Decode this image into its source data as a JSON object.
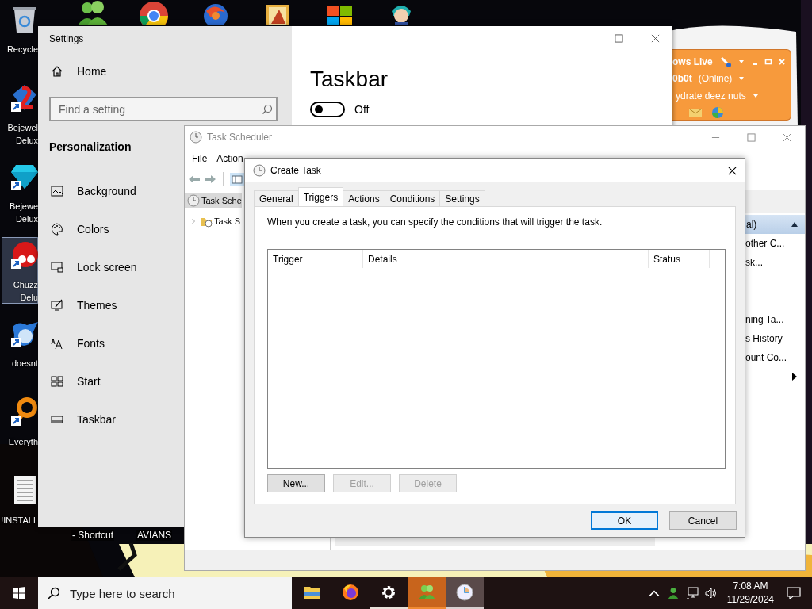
{
  "desktop": {
    "top_icons": [
      {
        "kind": "people"
      },
      {
        "kind": "ring"
      },
      {
        "kind": "swirl"
      },
      {
        "kind": "painting"
      },
      {
        "kind": "tiles"
      },
      {
        "kind": "figure"
      }
    ],
    "icons": [
      {
        "kind": "trash",
        "lines": [
          "Recycle"
        ],
        "shortcut": false,
        "selected": false
      },
      {
        "kind": "gem-red",
        "lines": [
          "Bejewel",
          "Delux"
        ],
        "shortcut": true,
        "selected": false
      },
      {
        "kind": "gem-blue",
        "lines": [
          "Bejewe",
          "Delux"
        ],
        "shortcut": true,
        "selected": false
      },
      {
        "kind": "creature",
        "lines": [
          "Chuzz",
          "Delu"
        ],
        "shortcut": true,
        "selected": true
      },
      {
        "kind": "bird",
        "lines": [
          "doesnt"
        ],
        "shortcut": true,
        "selected": false
      },
      {
        "kind": "magnifier",
        "lines": [
          "Everyth"
        ],
        "shortcut": true,
        "selected": false
      },
      {
        "kind": "document",
        "lines": [
          "!INSTALL"
        ],
        "shortcut": false,
        "selected": false
      }
    ],
    "partial_labels": [
      "- Shortcut",
      "AVIANS"
    ]
  },
  "messenger": {
    "title": "ows Live",
    "name": "0b0t",
    "status": "(Online)",
    "message": "ydrate deez nuts"
  },
  "settings": {
    "title": "Settings",
    "home": "Home",
    "search_placeholder": "Find a setting",
    "section": "Personalization",
    "nav": [
      {
        "kind": "picture",
        "label": "Background"
      },
      {
        "kind": "palette",
        "label": "Colors"
      },
      {
        "kind": "lock",
        "label": "Lock screen"
      },
      {
        "kind": "themes",
        "label": "Themes"
      },
      {
        "kind": "fonts",
        "label": "Fonts"
      },
      {
        "kind": "start",
        "label": "Start"
      },
      {
        "kind": "taskbar",
        "label": "Taskbar"
      }
    ],
    "page_title": "Taskbar",
    "toggle": {
      "on": false,
      "label": "Off"
    }
  },
  "task_scheduler": {
    "title": "Task Scheduler",
    "menu": [
      "File",
      "Action"
    ],
    "tree": [
      {
        "label": "Task Sche",
        "selected": true,
        "children": [
          {
            "label": "Task S",
            "selected": false
          }
        ]
      }
    ],
    "actions_header": "al)",
    "action_groups": [
      [
        {
          "kind": "text",
          "label": "other C..."
        },
        {
          "kind": "text",
          "label": "sk..."
        }
      ],
      [
        {
          "kind": "text",
          "label": "ning Ta..."
        },
        {
          "kind": "text",
          "label": "s History"
        },
        {
          "kind": "text",
          "label": "ount Co..."
        },
        {
          "kind": "submenu"
        }
      ]
    ]
  },
  "create_task": {
    "title": "Create Task",
    "tabs": [
      {
        "label": "General",
        "selected": false
      },
      {
        "label": "Triggers",
        "selected": true
      },
      {
        "label": "Actions",
        "selected": false
      },
      {
        "label": "Conditions",
        "selected": false
      },
      {
        "label": "Settings",
        "selected": false
      }
    ],
    "description": "When you create a task, you can specify the conditions that will trigger the task.",
    "columns": [
      "Trigger",
      "Details",
      "Status"
    ],
    "buttons": [
      {
        "label": "New...",
        "disabled": false
      },
      {
        "label": "Edit...",
        "disabled": true
      },
      {
        "label": "Delete",
        "disabled": true
      }
    ],
    "footer_buttons": [
      {
        "label": "OK",
        "default": true
      },
      {
        "label": "Cancel",
        "default": false
      }
    ]
  },
  "taskbar": {
    "search_placeholder": "Type here to search",
    "apps": [
      {
        "kind": "folder",
        "running": false,
        "flashing": false,
        "focused": false
      },
      {
        "kind": "firefox",
        "running": false,
        "flashing": false,
        "focused": false
      },
      {
        "kind": "gear",
        "running": true,
        "flashing": false,
        "focused": false
      },
      {
        "kind": "people",
        "running": true,
        "flashing": true,
        "focused": false
      },
      {
        "kind": "clock",
        "running": true,
        "flashing": false,
        "focused": true
      }
    ],
    "time": "7:08 AM",
    "date": "11/29/2024"
  }
}
